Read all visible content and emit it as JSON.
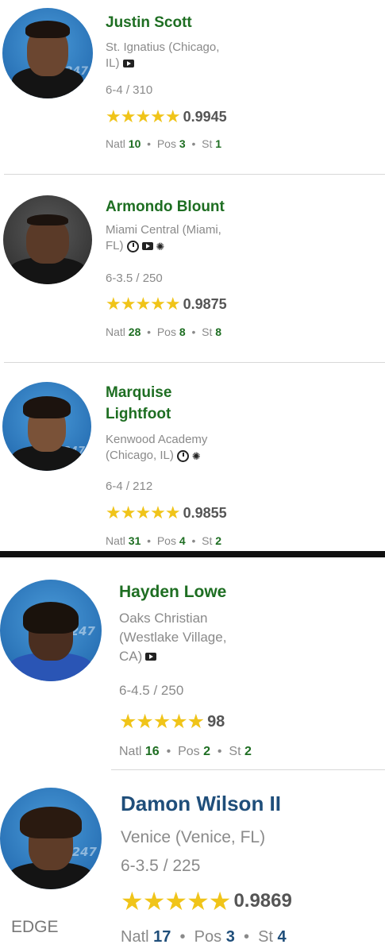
{
  "players": [
    {
      "name": "Justin Scott",
      "school_line1": "St. Ignatius (Chicago,",
      "school_line2": "IL)",
      "measurements": "6-4 / 310",
      "stars": "★★★★★",
      "score": "0.9945",
      "natl_label": "Natl",
      "natl": "10",
      "pos_label": "Pos",
      "pos": "3",
      "st_label": "St",
      "st": "1",
      "icons": [
        "youtube-icon"
      ]
    },
    {
      "name": "Armondo Blount",
      "school_line1": "Miami Central (Miami,",
      "school_line2": "FL)",
      "measurements": "6-3.5 / 250",
      "stars": "★★★★★",
      "score": "0.9875",
      "natl_label": "Natl",
      "natl": "28",
      "pos_label": "Pos",
      "pos": "8",
      "st_label": "St",
      "st": "8",
      "icons": [
        "clock-icon",
        "youtube-icon",
        "nbc-peacock-icon"
      ]
    },
    {
      "name_line1": "Marquise",
      "name_line2": "Lightfoot",
      "school_line1": "Kenwood Academy",
      "school_line2": "(Chicago, IL)",
      "measurements": "6-4 / 212",
      "stars": "★★★★★",
      "score": "0.9855",
      "natl_label": "Natl",
      "natl": "31",
      "pos_label": "Pos",
      "pos": "4",
      "st_label": "St",
      "st": "2",
      "icons": [
        "clock-icon",
        "nbc-peacock-icon"
      ]
    },
    {
      "name": "Hayden Lowe",
      "school_line1": "Oaks Christian",
      "school_line2": "(Westlake Village,",
      "school_line3": "CA)",
      "measurements": "6-4.5 / 250",
      "stars": "★★★★★",
      "score": "98",
      "natl_label": "Natl",
      "natl": "16",
      "pos_label": "Pos",
      "pos": "2",
      "st_label": "St",
      "st": "2",
      "icons": [
        "youtube-icon"
      ]
    },
    {
      "name": "Damon Wilson II",
      "school_line1": "Venice (Venice, FL)",
      "measurements": "6-3.5 / 225",
      "stars": "★★★★★",
      "score": "0.9869",
      "natl_label": "Natl",
      "natl": "17",
      "pos_label": "Pos",
      "pos": "3",
      "st_label": "St",
      "st": "4",
      "position_tag": "EDGE"
    }
  ],
  "colors": {
    "name_green": "#1e6e22",
    "name_blue": "#1f4e7a",
    "star_gold": "#f0c419",
    "avatar_blue": "#2a73b7"
  },
  "separator": "•"
}
